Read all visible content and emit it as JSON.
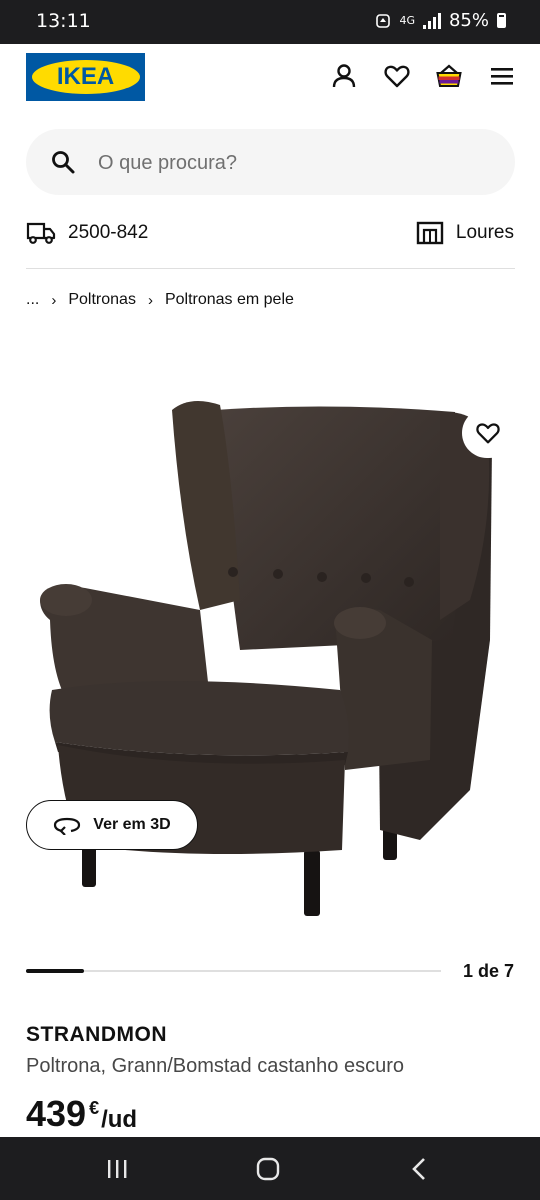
{
  "status_bar": {
    "time": "13:11",
    "network": "4G",
    "battery": "85%"
  },
  "header": {
    "logo_text": "IKEA",
    "icons": [
      "user-icon",
      "heart-icon",
      "basket-icon",
      "menu-icon"
    ]
  },
  "search": {
    "placeholder": "O que procura?"
  },
  "delivery": {
    "postcode": "2500-842",
    "store": "Loures"
  },
  "breadcrumb": {
    "ellipsis": "...",
    "items": [
      "Poltronas",
      "Poltronas em pele"
    ]
  },
  "media": {
    "view3d_label": "Ver em 3D",
    "counter": "1 de 7",
    "progress_fraction": 0.14
  },
  "product": {
    "name": "STRANDMON",
    "description": "Poltrona, Grann/Bomstad castanho escuro",
    "price": "439",
    "currency": "€",
    "unit": "/ud"
  },
  "colors": {
    "ikea_blue": "#0058a3",
    "ikea_yellow": "#ffdb00",
    "chair_brown": "#3b332f"
  }
}
